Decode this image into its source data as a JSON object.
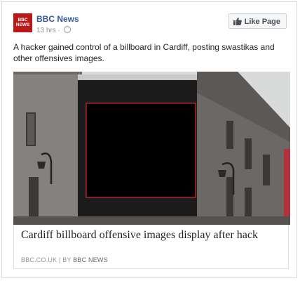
{
  "post": {
    "page_name": "BBC News",
    "logo_line1": "BBC",
    "logo_line2": "NEWS",
    "timestamp": "13 hrs",
    "separator": "·",
    "privacy_icon": "globe-icon",
    "like_button_label": "Like Page",
    "text": "A hacker gained control of a billboard in Cardiff, posting swastikas and other offensives images."
  },
  "link_card": {
    "title": "Cardiff billboard offensive images display after hack",
    "source": "BBC.CO.UK",
    "divider": "|",
    "by_label": "BY",
    "author": "BBC NEWS"
  },
  "colors": {
    "brand": "#bb1919",
    "link_blue": "#365899",
    "highlight_box": "#ff2b2b"
  }
}
